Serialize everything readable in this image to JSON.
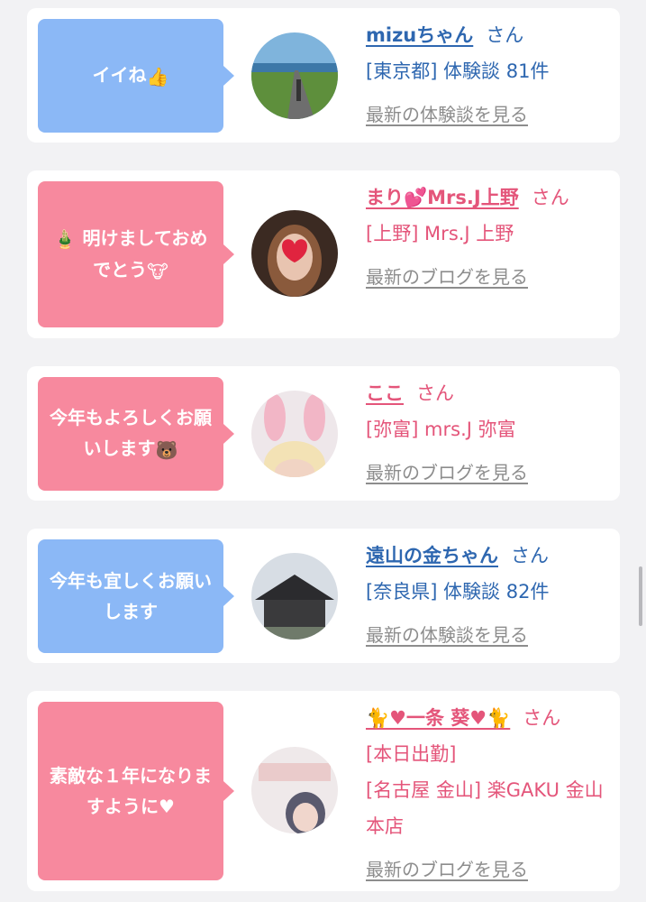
{
  "entries": [
    {
      "bubble_text": "イイね",
      "bubble_emoji": "👍",
      "name": "mizuちゃん",
      "suffix": "さん",
      "lines": [
        "[東京都] 体験談 81件"
      ],
      "link": "最新の体験談を見る",
      "theme": "blue",
      "avatar_icon": "road-landscape-icon"
    },
    {
      "bubble_text": "明けましておめでとう",
      "bubble_emoji_pre": "🎍",
      "bubble_emoji": "🐮",
      "name": "まり💕Mrs.J上野",
      "suffix": "さん",
      "lines": [
        "[上野] Mrs.J 上野"
      ],
      "link": "最新のブログを見る",
      "theme": "pink",
      "avatar_icon": "woman-photo-icon"
    },
    {
      "bubble_text": "今年もよろしくお願いします",
      "bubble_emoji": "🐻",
      "name": "ここ",
      "suffix": "さん",
      "lines": [
        "[弥富] mrs.J 弥富"
      ],
      "link": "最新のブログを見る",
      "theme": "pink",
      "avatar_icon": "bunny-ears-photo-icon"
    },
    {
      "bubble_text": "今年も宜しくお願いします",
      "name": "遠山の金ちゃん",
      "suffix": "さん",
      "lines": [
        "[奈良県] 体験談 82件"
      ],
      "link": "最新の体験談を見る",
      "theme": "blue",
      "avatar_icon": "temple-photo-icon"
    },
    {
      "bubble_text": "素敵な１年になりますように♥",
      "name": "🐈♥一条 葵♥🐈",
      "suffix": "さん",
      "lines": [
        "[本日出勤]",
        "[名古屋 金山] 楽GAKU 金山本店"
      ],
      "link": "最新のブログを見る",
      "theme": "pink",
      "avatar_icon": "2021-photo-icon"
    }
  ],
  "colors": {
    "blue_bubble": "#8bb8f6",
    "pink_bubble": "#f7899e",
    "blue_text": "#2e67b0",
    "pink_text": "#e4557a",
    "link_gray": "#8d8d8d"
  }
}
